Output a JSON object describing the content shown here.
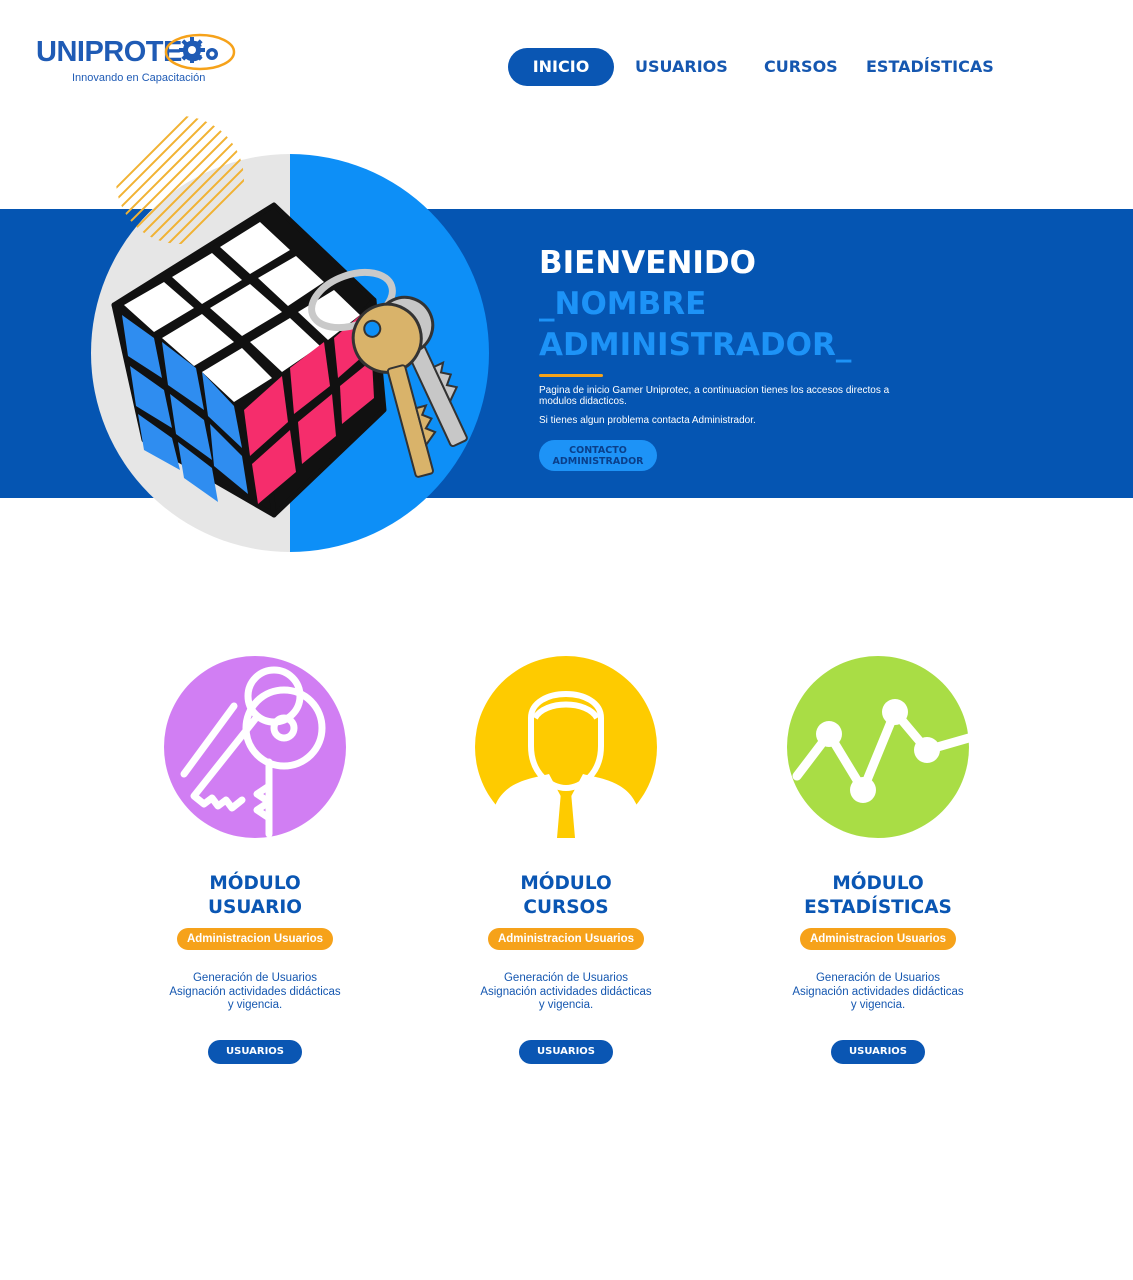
{
  "brand": {
    "name": "UNIPROTEC",
    "tagline": "Innovando en Capacitación"
  },
  "nav": {
    "items": [
      {
        "label": "INICIO",
        "active": true
      },
      {
        "label": "USUARIOS",
        "active": false
      },
      {
        "label": "CURSOS",
        "active": false
      },
      {
        "label": "ESTADÍSTICAS",
        "active": false
      }
    ]
  },
  "hero": {
    "title": "BIENVENIDO",
    "name_line1": "_NOMBRE",
    "name_line2": "ADMINISTRADOR_",
    "paragraph1": "Pagina de inicio Gamer Uniprotec, a continuacion tienes los accesos directos a modulos didacticos.",
    "paragraph2": "Si tienes algun problema contacta Administrador.",
    "button_line1": "CONTACTO",
    "button_line2": "ADMINISTRADOR"
  },
  "modules": [
    {
      "icon": "keys-icon",
      "title_line1": "MÓDULO",
      "title_line2": "USUARIO",
      "badge": "Administracion Usuarios",
      "desc_line1": "Generación de Usuarios",
      "desc_line2": "Asignación actividades didácticas",
      "desc_line3": "y vigencia.",
      "button": "USUARIOS",
      "color": "#d17ef3"
    },
    {
      "icon": "user-icon",
      "title_line1": "MÓDULO",
      "title_line2": "CURSOS",
      "badge": "Administracion Usuarios",
      "desc_line1": "Generación de Usuarios",
      "desc_line2": "Asignación actividades didácticas",
      "desc_line3": "y vigencia.",
      "button": "USUARIOS",
      "color": "#fecb00"
    },
    {
      "icon": "line-chart-icon",
      "title_line1": "MÓDULO",
      "title_line2": "ESTADÍSTICAS",
      "badge": "Administracion Usuarios",
      "desc_line1": "Generación de Usuarios",
      "desc_line2": "Asignación actividades didácticas",
      "desc_line3": "y vigencia.",
      "button": "USUARIOS",
      "color": "#a9dd45"
    }
  ],
  "colors": {
    "primary": "#0555b2",
    "accent_blue": "#1d93f7",
    "accent_orange": "#f6a21a"
  }
}
